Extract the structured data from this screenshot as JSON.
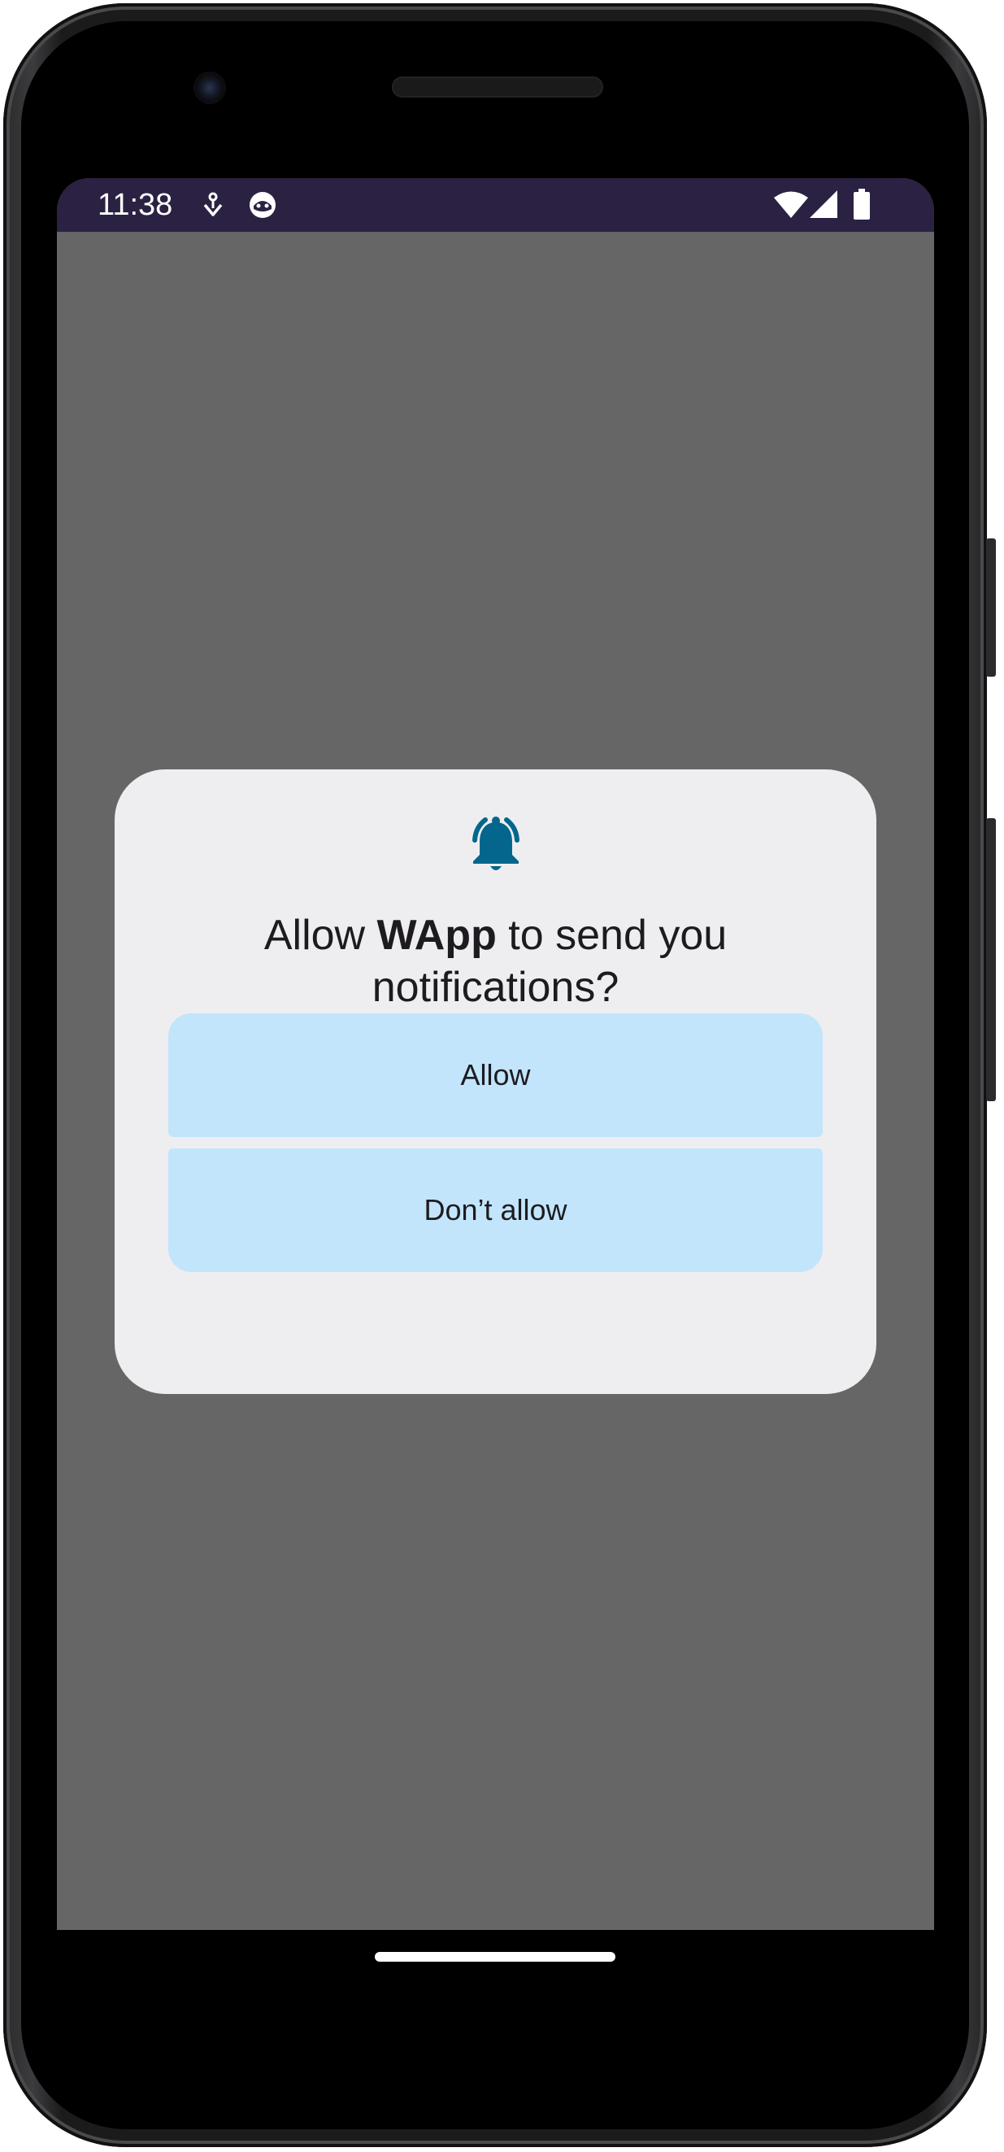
{
  "status_bar": {
    "time": "11:38",
    "left_icons": [
      "download-notification-icon",
      "app-notification-icon"
    ],
    "right_icons": [
      "wifi-icon",
      "cell-signal-icon",
      "battery-icon"
    ]
  },
  "dialog": {
    "icon": "bell-icon",
    "icon_color": "#05668d",
    "title_prefix": "Allow ",
    "title_app": "WApp",
    "title_suffix": " to send you notifications?",
    "allow_label": "Allow",
    "deny_label": "Don’t allow",
    "button_color": "#c2e5fb"
  },
  "colors": {
    "status_bar_bg": "#2b2142",
    "scrim": "#666666",
    "dialog_bg": "#eeeef0"
  }
}
